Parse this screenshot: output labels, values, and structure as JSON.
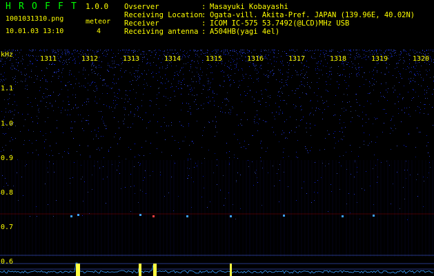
{
  "header": {
    "app_letters": [
      "H",
      "R",
      "O",
      "F",
      "F",
      "T"
    ],
    "version": "1.0.0",
    "filename": "1001031310.png",
    "datetime": "10.01.03 13:10",
    "meteor_label": "meteor",
    "meteor_count": "4"
  },
  "info": [
    {
      "key": "Ovserver",
      "value": "Masayuki Kobayashi"
    },
    {
      "key": "Receiving Location",
      "value": "Ogata-vill. Akita-Pref. JAPAN (139.96E, 40.02N)"
    },
    {
      "key": "Receiver",
      "value": "ICOM IC-575 53.7492(@LCD)MHz USB"
    },
    {
      "key": "Receiving antenna",
      "value": "A504HB(yagi 4el)"
    }
  ],
  "spectrogram": {
    "unit_label": "kHz",
    "y_ticks": [
      "1.1",
      "1.0",
      "0.9",
      "0.8",
      "0.7",
      "0.6"
    ],
    "x_ticks": [
      "1311",
      "1312",
      "1313",
      "1314",
      "1315",
      "1316",
      "1317",
      "1318",
      "1319",
      "1320"
    ],
    "colors": {
      "text": "#ffff00",
      "grid": "#ff0000",
      "signal": "#1a2dff",
      "trace": "#3aa0ff"
    }
  }
}
